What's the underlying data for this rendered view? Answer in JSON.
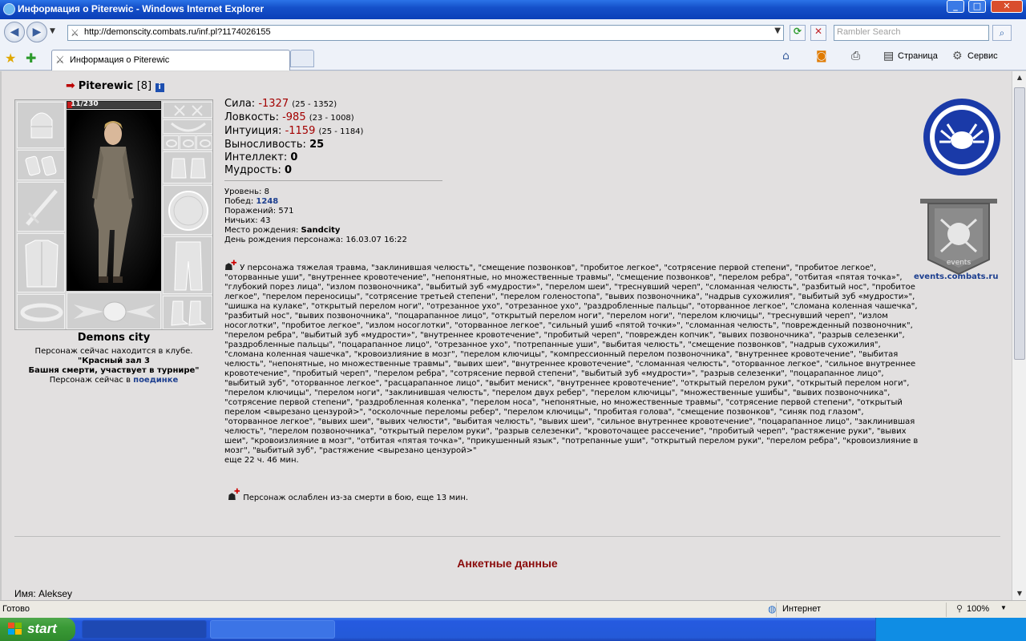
{
  "window": {
    "title": "Информация о Piterewic - Windows Internet Explorer"
  },
  "address_bar": {
    "url": "http://demonscity.combats.ru/inf.pl?1174026155",
    "search_placeholder": "Rambler Search"
  },
  "tabs": [
    {
      "label": "Информация о Piterewic",
      "active": true
    }
  ],
  "command_bar": {
    "page_label": "Страница",
    "tools_label": "Сервис"
  },
  "character": {
    "name": "Piterewic",
    "level_label": "[8]",
    "hp_text": "11/230",
    "hp_fraction": 0.048,
    "city": "Demons city",
    "location_line1": "Персонаж сейчас находится в клубе.",
    "location_line2": "\"Красный зал 3",
    "location_line3": "Башня смерти, участвует в турнире\"",
    "duel_prefix": "Персонаж сейчас в ",
    "duel_link": "поединке"
  },
  "stats": [
    {
      "label": "Сила: ",
      "value": "-1327",
      "range": "(25 - 1352)",
      "negative": true
    },
    {
      "label": "Ловкость: ",
      "value": "-985",
      "range": "(23 - 1008)",
      "negative": true
    },
    {
      "label": "Интуиция: ",
      "value": "-1159",
      "range": "(25 - 1184)",
      "negative": true
    },
    {
      "label": "Выносливость: ",
      "value": "25",
      "range": "",
      "negative": false
    },
    {
      "label": "Интеллект: ",
      "value": "0",
      "range": "",
      "negative": false
    },
    {
      "label": "Мудрость: ",
      "value": "0",
      "range": "",
      "negative": false
    }
  ],
  "meta": {
    "level": "Уровень: 8",
    "wins_label": "Побед: ",
    "wins_value": "1248",
    "losses": "Поражений: 571",
    "draws": "Ничьих: 43",
    "birthplace_label": "Место рождения: ",
    "birthplace_value": "Sandcity",
    "birthday": "День рождения персонажа: 16.03.07 16:22"
  },
  "injury_text": "У персонажа тяжелая травма, \"заклинившая челюсть\", \"смещение позвонков\", \"пробитое легкое\", \"сотрясение первой степени\", \"пробитое легкое\", \"оторванные уши\", \"внутреннее кровотечение\", \"непонятные, но множественные травмы\", \"смещение позвонков\", \"перелом ребра\", \"отбитая «пятая точка»\", \"глубокий порез лица\", \"излом позвоночника\", \"выбитый зуб «мудрости»\", \"перелом шеи\", \"треснувший череп\", \"сломанная челюсть\", \"разбитый нос\", \"пробитое легкое\", \"перелом переносицы\", \"сотрясение третьей степени\", \"перелом голеностопа\", \"вывих позвоночника\", \"надрыв сухожилия\", \"выбитый зуб «мудрости»\", \"шишка на кулаке\", \"открытый перелом ноги\", \"отрезанное ухо\", \"отрезанное ухо\", \"раздробленные пальцы\", \"оторванное легкое\", \"сломана коленная чашечка\", \"разбитый нос\", \"вывих позвоночника\", \"поцарапанное лицо\", \"открытый перелом ноги\", \"перелом ноги\", \"перелом ключицы\", \"треснувший череп\", \"излом носоглотки\", \"пробитое легкое\", \"излом носоглотки\", \"оторванное легкое\", \"сильный ушиб «пятой точки»\", \"сломанная челюсть\", \"поврежденный позвоночник\", \"перелом ребра\", \"выбитый зуб «мудрости»\", \"внутреннее кровотечение\", \"пробитый череп\", \"поврежден копчик\", \"вывих позвоночника\", \"разрыв селезенки\", \"раздробленные пальцы\", \"поцарапанное лицо\", \"отрезанное ухо\", \"потрепанные уши\", \"выбитая челюсть\", \"смещение позвонков\", \"надрыв сухожилия\", \"сломана коленная чашечка\", \"кровоизлияние в мозг\", \"перелом ключицы\", \"компрессионный перелом позвоночника\", \"внутреннее кровотечение\", \"выбитая челюсть\", \"непонятные, но множественные травмы\", \"вывих шеи\", \"внутреннее кровотечение\", \"сломанная челюсть\", \"оторванное легкое\", \"сильное внутреннее кровотечение\", \"пробитый череп\", \"перелом ребра\", \"сотрясение первой степени\", \"выбитый зуб «мудрости»\", \"разрыв селезенки\", \"поцарапанное лицо\", \"выбитый зуб\", \"оторванное легкое\", \"расцарапанное лицо\", \"выбит мениск\", \"внутреннее кровотечение\", \"открытый перелом руки\", \"открытый перелом ноги\", \"перелом ключицы\", \"перелом ноги\", \"заклинившая челюсть\", \"перелом двух ребер\", \"перелом ключицы\", \"множественные ушибы\", \"вывих позвоночника\", \"сотрясение первой степени\", \"раздробленная коленка\", \"перелом носа\", \"непонятные, но множественные травмы\", \"сотрясение первой степени\", \"открытый перелом <вырезано цензурой>\", \"осколочные переломы ребер\", \"перелом ключицы\", \"пробитая голова\", \"смещение позвонков\", \"синяк под глазом\", \"оторванное легкое\", \"вывих шеи\", \"вывих челюсти\", \"выбитая челюсть\", \"вывих шеи\", \"сильное внутреннее кровотечение\", \"поцарапанное лицо\", \"заклинившая челюсть\", \"перелом позвоночника\", \"открытый перелом руки\", \"разрыв селезенки\", \"кровоточащее рассечение\", \"пробитый череп\", \"растяжение руки\", \"вывих шеи\", \"кровоизлияние в мозг\", \"отбитая «пятая точка»\", \"прикушенный язык\", \"потрепанные уши\", \"открытый перелом руки\", \"перелом ребра\", \"кровоизлияние в мозг\", \"выбитый зуб\", \"растяжение <вырезано цензурой>\"",
  "injury_remaining": "еще 22 ч. 46 мин.",
  "weakened_text": "Персонаж ослаблен из-за смерти в бою, еще 13 мин.",
  "events_link": "events.combats.ru",
  "events_logo_text": "events",
  "section_title": "Анкетные данные",
  "profile_name": "Имя: Aleksey",
  "status_bar": {
    "status": "Готово",
    "zone": "Интернет",
    "zoom": "100%"
  },
  "taskbar": {
    "start_label": "start"
  },
  "colors": {
    "negative_stat": "#a30000",
    "link": "#1d3f8f",
    "section_title": "#8a0b0b",
    "clan_blue": "#1a3aa8"
  }
}
